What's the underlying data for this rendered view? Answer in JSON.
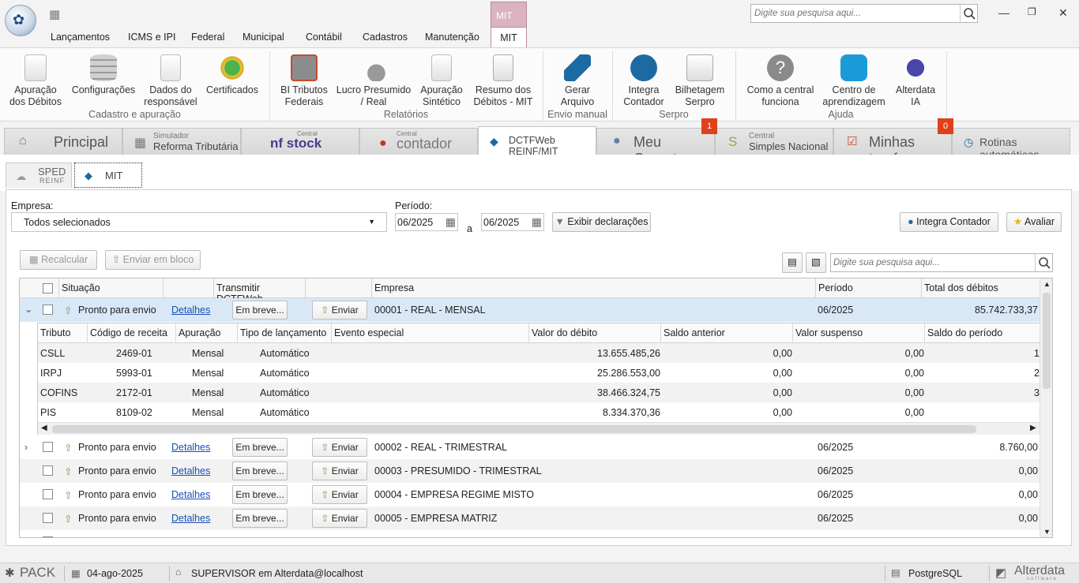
{
  "app": {
    "search_placeholder": "Digite sua pesquisa aqui...",
    "menu": [
      "Lançamentos",
      "ICMS e IPI",
      "Federal",
      "Municipal",
      "Contábil",
      "Cadastros",
      "Manutenção"
    ],
    "context_group": "MIT",
    "context_tab": "MIT"
  },
  "ribbon": {
    "buttons": [
      {
        "label": "Apuração\ndos Débitos",
        "icon": "document-icon"
      },
      {
        "label": "Configurações",
        "icon": "database-icon"
      },
      {
        "label": "Dados do\nresponsável",
        "icon": "document-icon"
      },
      {
        "label": "Certificados",
        "icon": "certificate-icon"
      },
      {
        "label": "BI Tributos\nFederais",
        "icon": "money-doc-icon"
      },
      {
        "label": "Lucro Presumido\n/ Real",
        "icon": "profit-icon"
      },
      {
        "label": "Apuração\nSintético",
        "icon": "edit-doc-icon"
      },
      {
        "label": "Resumo dos\nDébitos - MIT",
        "icon": "docs-icon"
      },
      {
        "label": "Gerar\nArquivo",
        "icon": "send-icon"
      },
      {
        "label": "Integra\nContador",
        "icon": "integra-icon"
      },
      {
        "label": "Bilhetagem\nSerpro",
        "icon": "chart-money-icon"
      },
      {
        "label": "Como a central\nfunciona",
        "icon": "help-icon"
      },
      {
        "label": "Centro de\naprendizagem",
        "icon": "learning-icon"
      },
      {
        "label": "Alterdata\nIA",
        "icon": "ai-icon"
      }
    ],
    "groups": [
      "Cadastro e apuração",
      "Relatórios",
      "Envio manual",
      "Serpro",
      "Ajuda"
    ]
  },
  "tabs": {
    "principal": "Principal",
    "simulador_small": "Simulador",
    "simulador": "Reforma Tributária",
    "nfstock_small": "Central",
    "nfstock": "nf stock",
    "contador_small": "Central",
    "contador": "contador",
    "dctf": "DCTFWeb REINF/MIT",
    "gerente": "Meu Gerente",
    "simples_small": "Central",
    "simples": "Simples Nacional",
    "tarefas": "Minhas tarefas",
    "rotinas": "Rotinas automáticas",
    "badge_gerente": "1",
    "badge_tarefas": "0"
  },
  "subtabs": {
    "sped": "SPED",
    "reinf": "REINF",
    "mit": "MIT"
  },
  "filters": {
    "empresa_label": "Empresa:",
    "empresa_value": "Todos selecionados",
    "periodo_label": "Período:",
    "periodo_from": "06/2025",
    "periodo_sep": "a",
    "periodo_to": "06/2025",
    "exibir": "Exibir declarações",
    "integra": "Integra Contador",
    "avaliar": "Avaliar"
  },
  "toolbar": {
    "recalcular": "Recalcular",
    "enviar_bloco": "Enviar em bloco",
    "search_placeholder": "Digite sua pesquisa aqui..."
  },
  "grid": {
    "headers": [
      "Situação",
      "",
      "Transmitir DCTFWeb",
      "",
      "Empresa",
      "Período",
      "Total dos débitos"
    ],
    "rows": [
      {
        "situacao": "Pronto para envio",
        "detalhes": "Detalhes",
        "embreve": "Em breve...",
        "enviar": "Enviar",
        "empresa": "00001 - REAL - MENSAL",
        "periodo": "06/2025",
        "total": "85.742.733,37",
        "expanded": true
      },
      {
        "situacao": "Pronto para envio",
        "detalhes": "Detalhes",
        "embreve": "Em breve...",
        "enviar": "Enviar",
        "empresa": "00002 - REAL - TRIMESTRAL",
        "periodo": "06/2025",
        "total": "8.760,00",
        "expanded": false
      },
      {
        "situacao": "Pronto para envio",
        "detalhes": "Detalhes",
        "embreve": "Em breve...",
        "enviar": "Enviar",
        "empresa": "00003 - PRESUMIDO - TRIMESTRAL",
        "periodo": "06/2025",
        "total": "0,00",
        "expanded": false
      },
      {
        "situacao": "Pronto para envio",
        "detalhes": "Detalhes",
        "embreve": "Em breve...",
        "enviar": "Enviar",
        "empresa": "00004 - EMPRESA REGIME MISTO",
        "periodo": "06/2025",
        "total": "0,00",
        "expanded": false
      },
      {
        "situacao": "Pronto para envio",
        "detalhes": "Detalhes",
        "embreve": "Em breve...",
        "enviar": "Enviar",
        "empresa": "00005 - EMPRESA MATRIZ",
        "periodo": "06/2025",
        "total": "0,00",
        "expanded": false
      }
    ],
    "detail_headers": [
      "Tributo",
      "Código de receita",
      "Apuração",
      "Tipo de lançamento",
      "Evento especial",
      "Valor do débito",
      "Saldo anterior",
      "Valor suspenso",
      "Saldo do período"
    ],
    "detail_rows": [
      {
        "tributo": "CSLL",
        "codigo": "2469-01",
        "apuracao": "Mensal",
        "tipo": "Automático",
        "evento": "",
        "valor": "13.655.485,26",
        "saldo_ant": "0,00",
        "suspenso": "0,00",
        "saldo": "1"
      },
      {
        "tributo": "IRPJ",
        "codigo": "5993-01",
        "apuracao": "Mensal",
        "tipo": "Automático",
        "evento": "",
        "valor": "25.286.553,00",
        "saldo_ant": "0,00",
        "suspenso": "0,00",
        "saldo": "2"
      },
      {
        "tributo": "COFINS",
        "codigo": "2172-01",
        "apuracao": "Mensal",
        "tipo": "Automático",
        "evento": "",
        "valor": "38.466.324,75",
        "saldo_ant": "0,00",
        "suspenso": "0,00",
        "saldo": "3"
      },
      {
        "tributo": "PIS",
        "codigo": "8109-02",
        "apuracao": "Mensal",
        "tipo": "Automático",
        "evento": "",
        "valor": "8.334.370,36",
        "saldo_ant": "0,00",
        "suspenso": "0,00",
        "saldo": ""
      }
    ]
  },
  "status": {
    "pack": "PACK",
    "date": "04-ago-2025",
    "user": "SUPERVISOR em Alterdata@localhost",
    "db": "PostgreSQL",
    "brand": "Alterdata",
    "brand_sub": "software"
  },
  "colors": {
    "accent": "#1a4fb0",
    "context": "#b98a97",
    "badge": "#e0401a",
    "selected_row": "#d9e8f7"
  }
}
